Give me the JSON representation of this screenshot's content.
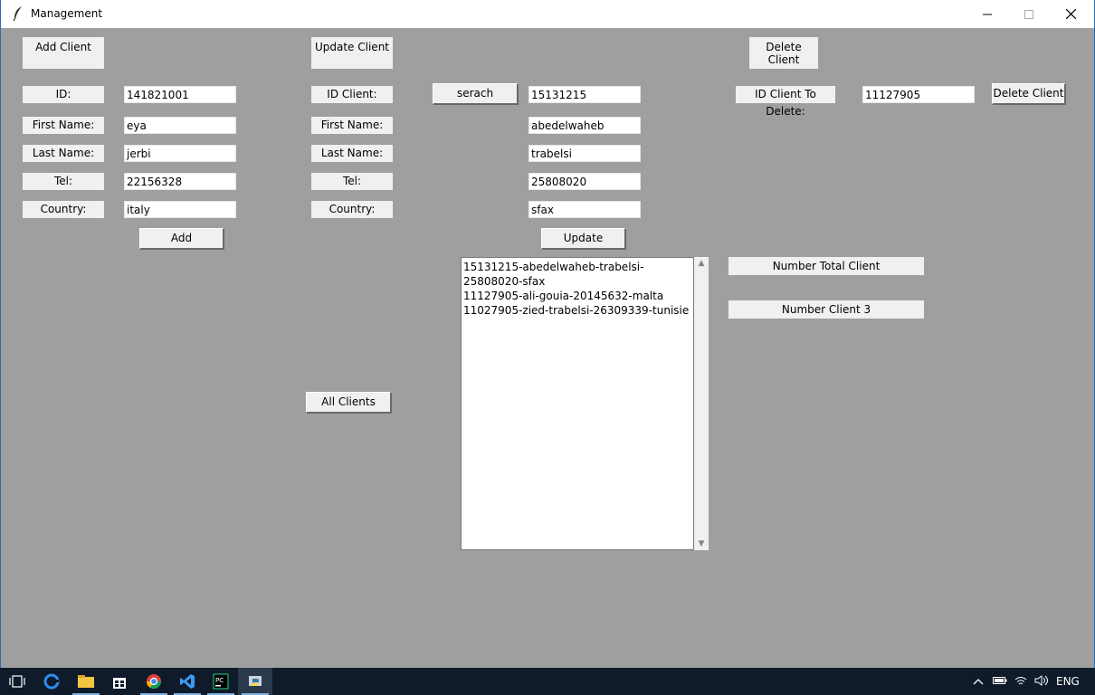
{
  "window": {
    "title": "Management"
  },
  "add": {
    "header": "Add Client",
    "labels": {
      "id": "ID:",
      "first": "First Name:",
      "last": "Last Name:",
      "tel": "Tel:",
      "country": "Country:"
    },
    "values": {
      "id": "141821001",
      "first": "eya",
      "last": "jerbi",
      "tel": "22156328",
      "country": "italy"
    },
    "button": "Add"
  },
  "update": {
    "header": "Update Client",
    "labels": {
      "id": "ID Client:",
      "first": "First Name:",
      "last": "Last Name:",
      "tel": "Tel:",
      "country": "Country:"
    },
    "search_button": "serach",
    "values": {
      "id": "15131215",
      "first": "abedelwaheb",
      "last": "trabelsi",
      "tel": "25808020",
      "country": "sfax"
    },
    "button": "Update",
    "all_button": "All Clients"
  },
  "delete": {
    "header": "Delete Client",
    "label": "ID Client To Delete:",
    "value": "11127905",
    "button": "Delete Client"
  },
  "clients": [
    "15131215-abedelwaheb-trabelsi-25808020-sfax",
    "11127905-ali-gouia-20145632-malta",
    "11027905-zied-trabelsi-26309339-tunisie"
  ],
  "stats": {
    "total_label": "Number Total Client",
    "count_label": "Number Client 3"
  },
  "tray": {
    "lang": "ENG"
  },
  "icons": [
    "feather-icon",
    "minimize-icon",
    "maximize-icon",
    "close-icon",
    "task-view-icon",
    "edge-icon",
    "file-explorer-icon",
    "store-icon",
    "chrome-icon",
    "visual-studio-icon",
    "pycharm-icon",
    "python-icon",
    "chevron-up-icon",
    "battery-icon",
    "wifi-icon",
    "volume-icon"
  ]
}
